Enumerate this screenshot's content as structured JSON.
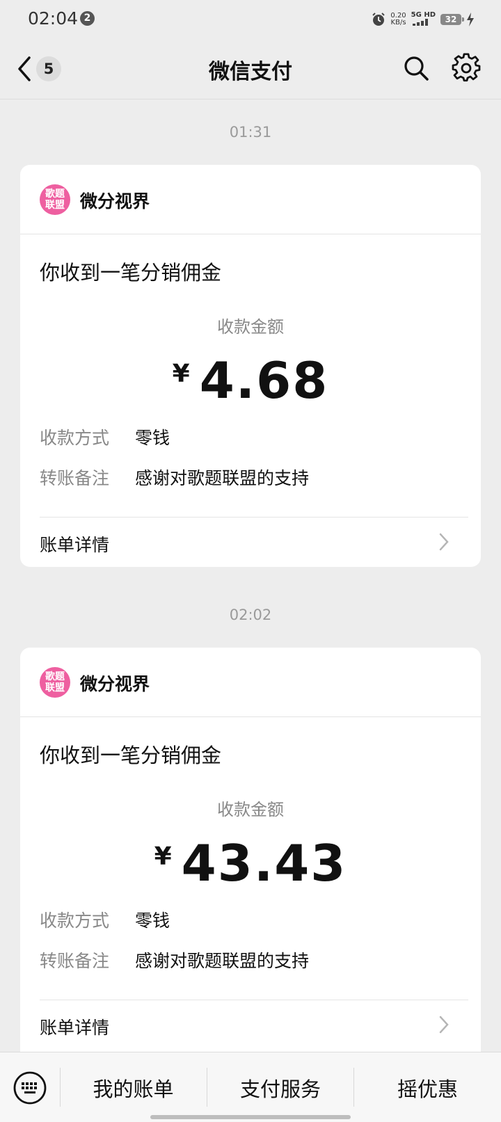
{
  "status_bar": {
    "time": "02:04",
    "notification_count": "2",
    "net_speed_value": "0.20",
    "net_speed_unit": "KB/s",
    "network": "5G HD",
    "battery": "32"
  },
  "nav": {
    "title": "微信支付",
    "back_count": "5"
  },
  "messages": [
    {
      "timestamp": "01:31",
      "merchant": "微分视界",
      "avatar_text_line1": "歌题",
      "avatar_text_line2": "联盟",
      "title": "你收到一笔分销佣金",
      "amount_label": "收款金额",
      "currency": "¥",
      "amount": "4.68",
      "method_label": "收款方式",
      "method_value": "零钱",
      "note_label": "转账备注",
      "note_value": "感谢对歌题联盟的支持",
      "detail_label": "账单详情"
    },
    {
      "timestamp": "02:02",
      "merchant": "微分视界",
      "avatar_text_line1": "歌题",
      "avatar_text_line2": "联盟",
      "title": "你收到一笔分销佣金",
      "amount_label": "收款金额",
      "currency": "¥",
      "amount": "43.43",
      "method_label": "收款方式",
      "method_value": "零钱",
      "note_label": "转账备注",
      "note_value": "感谢对歌题联盟的支持",
      "detail_label": "账单详情"
    }
  ],
  "bottom_menu": {
    "items": [
      "我的账单",
      "支付服务",
      "摇优惠"
    ]
  },
  "icons": {
    "back": "chevron-left-icon",
    "search": "search-icon",
    "settings": "gear-icon",
    "keyboard": "keyboard-icon",
    "detail": "chevron-right-icon"
  },
  "colors": {
    "background": "#ededed",
    "card": "#ffffff",
    "avatar": "#ee5fa0",
    "muted_text": "#888888"
  }
}
